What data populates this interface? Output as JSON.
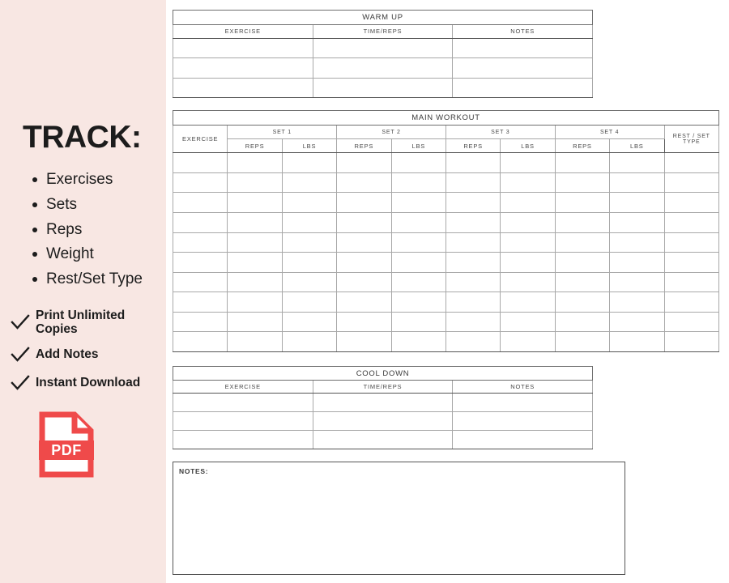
{
  "sidebar": {
    "heading": "TRACK:",
    "track_items": [
      {
        "label": "Exercises"
      },
      {
        "label": "Sets"
      },
      {
        "label": "Reps"
      },
      {
        "label": "Weight"
      },
      {
        "label": "Rest/Set Type"
      }
    ],
    "features": [
      {
        "icon": "check-icon",
        "label": "Print Unlimited Copies"
      },
      {
        "icon": "check-icon",
        "label": "Add Notes"
      },
      {
        "icon": "check-icon",
        "label": "Instant Download"
      }
    ],
    "file_badge": {
      "icon": "pdf-file-icon",
      "label": "PDF"
    },
    "colors": {
      "background": "#f8e7e3",
      "accent": "#ef4a4a",
      "text": "#1c1c1c"
    }
  },
  "worksheet": {
    "colors": {
      "title_pink": "#f5d4cd",
      "header_pink": "#f7ded9",
      "exercise_cream": "#f4ece1",
      "lbs_tint": "#f9e6e2",
      "border": "#a8a8a8",
      "border_strong": "#555555"
    },
    "warm_up": {
      "title": "WARM UP",
      "columns": [
        "EXERCISE",
        "TIME/REPS",
        "NOTES"
      ],
      "row_count": 3,
      "rows": [
        [
          "",
          "",
          ""
        ],
        [
          "",
          "",
          ""
        ],
        [
          "",
          "",
          ""
        ]
      ]
    },
    "main_workout": {
      "title": "MAIN WORKOUT",
      "exercise_column": "EXERCISE",
      "sets": [
        {
          "label": "SET 1",
          "sub_columns": [
            "REPS",
            "LBS"
          ]
        },
        {
          "label": "SET 2",
          "sub_columns": [
            "REPS",
            "LBS"
          ]
        },
        {
          "label": "SET 3",
          "sub_columns": [
            "REPS",
            "LBS"
          ]
        },
        {
          "label": "SET 4",
          "sub_columns": [
            "REPS",
            "LBS"
          ]
        }
      ],
      "rest_column": "REST / SET TYPE",
      "row_count": 10,
      "rows": [
        [
          "",
          "",
          "",
          "",
          "",
          "",
          "",
          "",
          "",
          ""
        ],
        [
          "",
          "",
          "",
          "",
          "",
          "",
          "",
          "",
          "",
          ""
        ],
        [
          "",
          "",
          "",
          "",
          "",
          "",
          "",
          "",
          "",
          ""
        ],
        [
          "",
          "",
          "",
          "",
          "",
          "",
          "",
          "",
          "",
          ""
        ],
        [
          "",
          "",
          "",
          "",
          "",
          "",
          "",
          "",
          "",
          ""
        ],
        [
          "",
          "",
          "",
          "",
          "",
          "",
          "",
          "",
          "",
          ""
        ],
        [
          "",
          "",
          "",
          "",
          "",
          "",
          "",
          "",
          "",
          ""
        ],
        [
          "",
          "",
          "",
          "",
          "",
          "",
          "",
          "",
          "",
          ""
        ],
        [
          "",
          "",
          "",
          "",
          "",
          "",
          "",
          "",
          "",
          ""
        ],
        [
          "",
          "",
          "",
          "",
          "",
          "",
          "",
          "",
          "",
          ""
        ]
      ]
    },
    "cool_down": {
      "title": "COOL DOWN",
      "columns": [
        "EXERCISE",
        "TIME/REPS",
        "NOTES"
      ],
      "row_count": 3,
      "rows": [
        [
          "",
          "",
          ""
        ],
        [
          "",
          "",
          ""
        ],
        [
          "",
          "",
          ""
        ]
      ]
    },
    "notes": {
      "label": "NOTES:",
      "value": ""
    }
  }
}
